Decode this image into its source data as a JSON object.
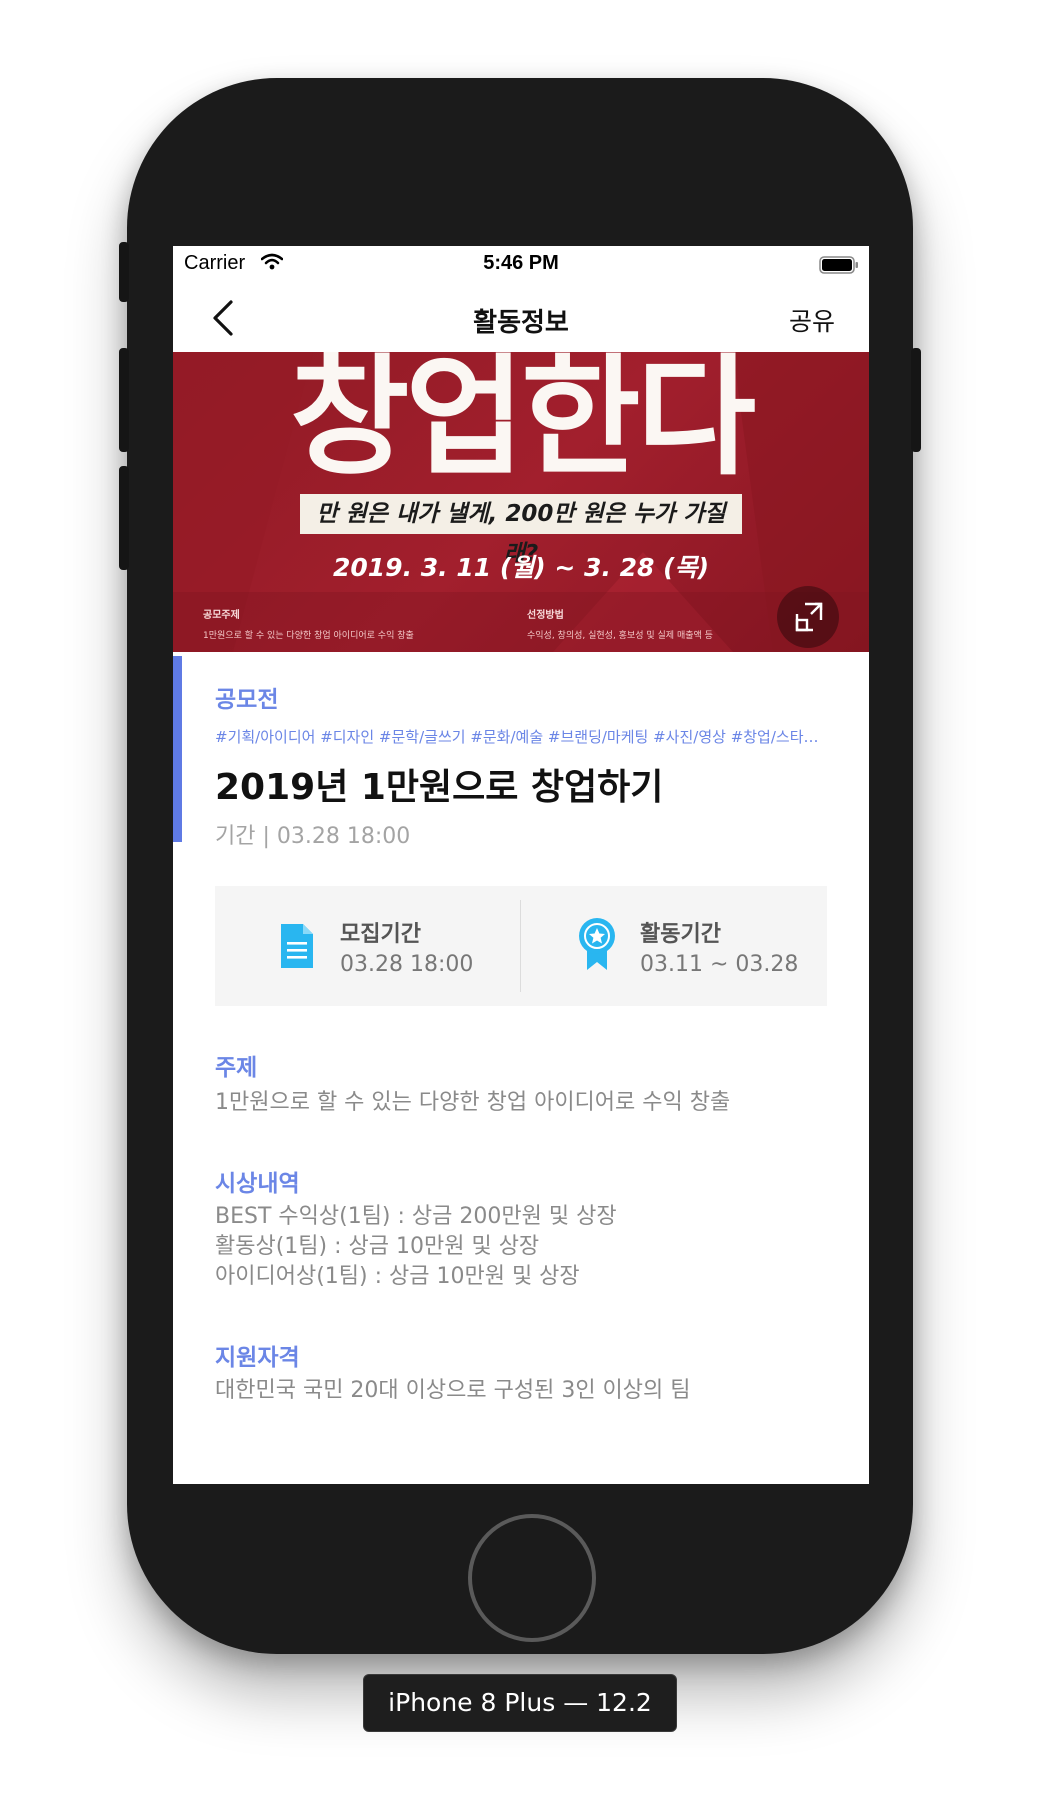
{
  "status_bar": {
    "carrier": "Carrier",
    "time": "5:46 PM"
  },
  "nav": {
    "title": "활동정보",
    "share_label": "공유"
  },
  "banner": {
    "headline": "창업한다",
    "subheadline": "만 원은 내가 낼게, 200만 원은 누가 가질래?",
    "date": "2019. 3. 11 (월) ~ 3. 28 (목)",
    "label_left": "공모주제",
    "label_right": "선정방법",
    "small_left": "1만원으로 할 수 있는 다양한 창업 아이디어로 수익 창출",
    "small_right": "수익성, 창의성, 실현성, 홍보성 및 실제 매출액 등"
  },
  "activity": {
    "category": "공모전",
    "tags": "#기획/아이디어 #디자인 #문학/글쓰기 #문화/예술 #브랜딩/마케팅 #사진/영상 #창업/스타…",
    "title": "2019년 1만원으로 창업하기",
    "period": "기간 | 03.28 18:00"
  },
  "info": {
    "recruit_label": "모집기간",
    "recruit_value": "03.28 18:00",
    "activity_label": "활동기간",
    "activity_value": "03.11 ~ 03.28"
  },
  "sections": {
    "topic_title": "주제",
    "topic_body": "1만원으로 할 수 있는 다양한 창업 아이디어로 수익 창출",
    "prize_title": "시상내역",
    "prize_lines": [
      "BEST 수익상(1팀) : 상금 200만원 및 상장",
      "활동상(1팀) : 상금 10만원 및 상장",
      "아이디어상(1팀) : 상금 10만원 및 상장"
    ],
    "eligibility_title": "지원자격",
    "eligibility_body": "대한민국 국민 20대 이상으로 구성된 3인 이상의 팀"
  },
  "device_label": "iPhone 8 Plus — 12.2",
  "colors": {
    "accent": "#6b86e6",
    "banner": "#a21f2d",
    "icon_blue": "#29b6f0"
  }
}
